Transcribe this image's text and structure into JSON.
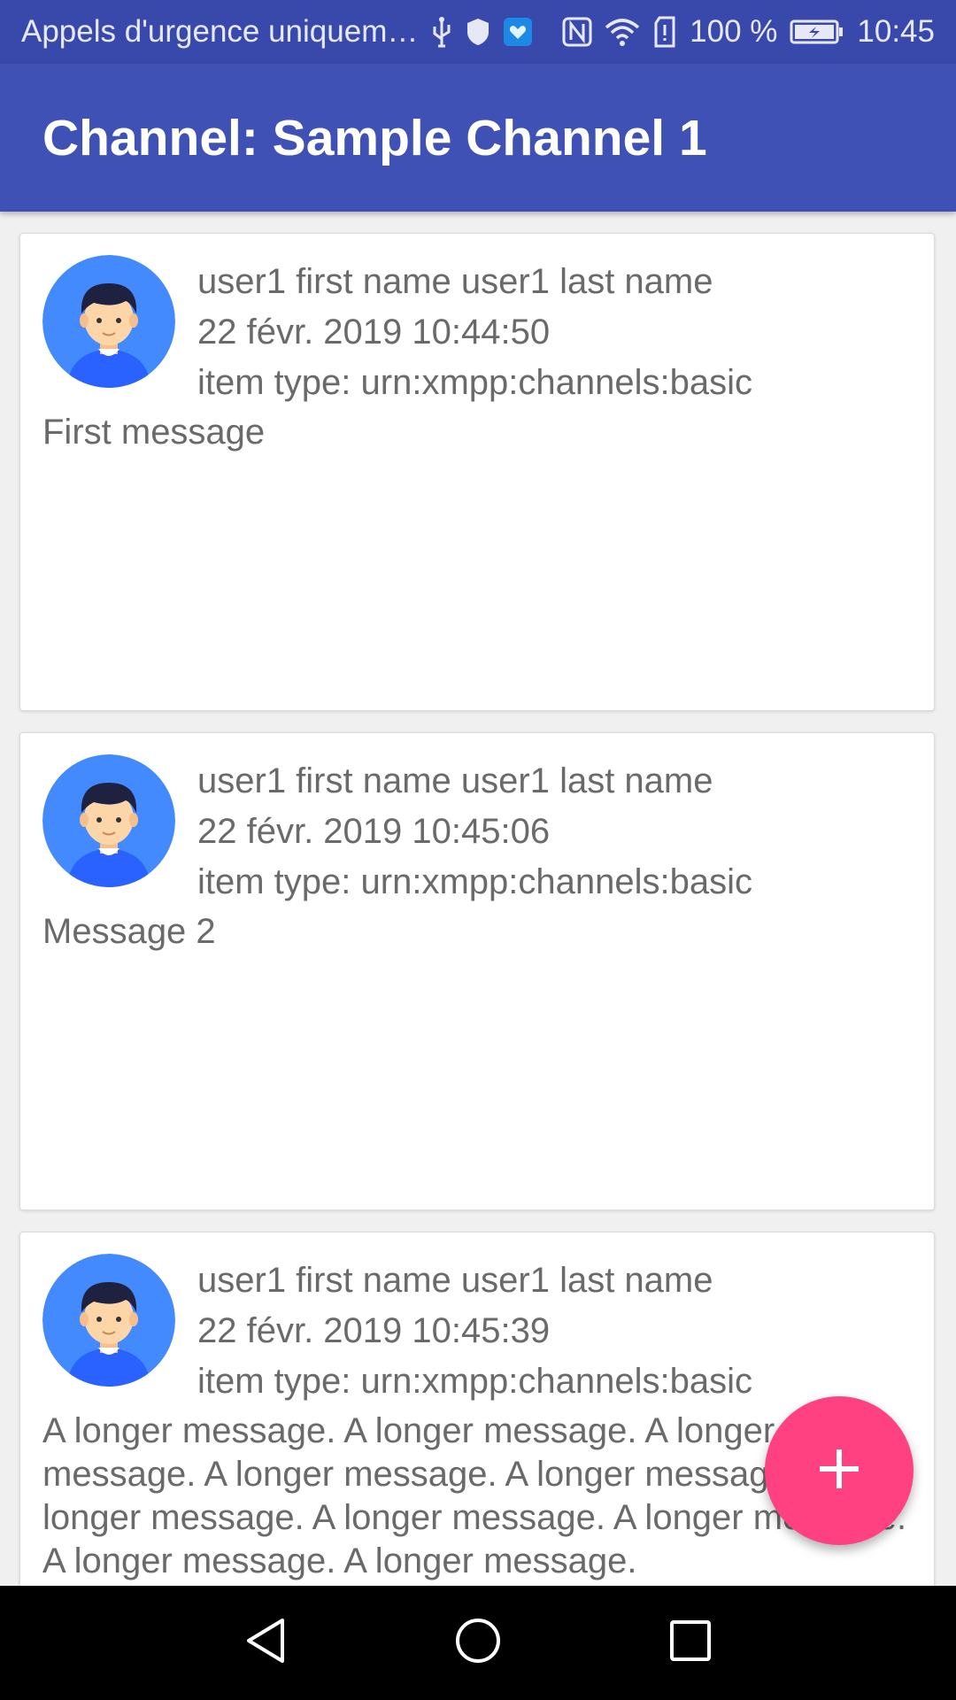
{
  "status_bar": {
    "carrier_text": "Appels d'urgence uniquem…",
    "battery": "100 %",
    "time": "10:45",
    "left_icons": [
      "usb-icon",
      "shield-icon",
      "app-notification-icon"
    ],
    "right_icons": [
      "nfc-icon",
      "wifi-icon",
      "sim-alert-icon",
      "battery-charging-icon"
    ]
  },
  "app_bar": {
    "title": "Channel: Sample Channel 1"
  },
  "items": [
    {
      "author": "user1 first name user1 last name",
      "date": "22 févr. 2019 10:44:50",
      "item_type": "item type: urn:xmpp:channels:basic",
      "message": "First message"
    },
    {
      "author": "user1 first name user1 last name",
      "date": "22 févr. 2019 10:45:06",
      "item_type": "item type: urn:xmpp:channels:basic",
      "message": "Message 2"
    },
    {
      "author": "user1 first name user1 last name",
      "date": "22 févr. 2019 10:45:39",
      "item_type": "item type: urn:xmpp:channels:basic",
      "message": "A longer message. A longer message. A longer message. A longer message. A longer message. A longer message. A longer message. A longer message. A longer message. A longer message."
    }
  ],
  "fab": {
    "icon": "plus-icon"
  },
  "nav_bar": {
    "icons": [
      "back-icon",
      "home-icon",
      "recents-icon"
    ]
  },
  "colors": {
    "status_bar": "#3949ab",
    "app_bar": "#3f51b5",
    "fab": "#ff4081",
    "avatar_bg": "#448aff"
  }
}
